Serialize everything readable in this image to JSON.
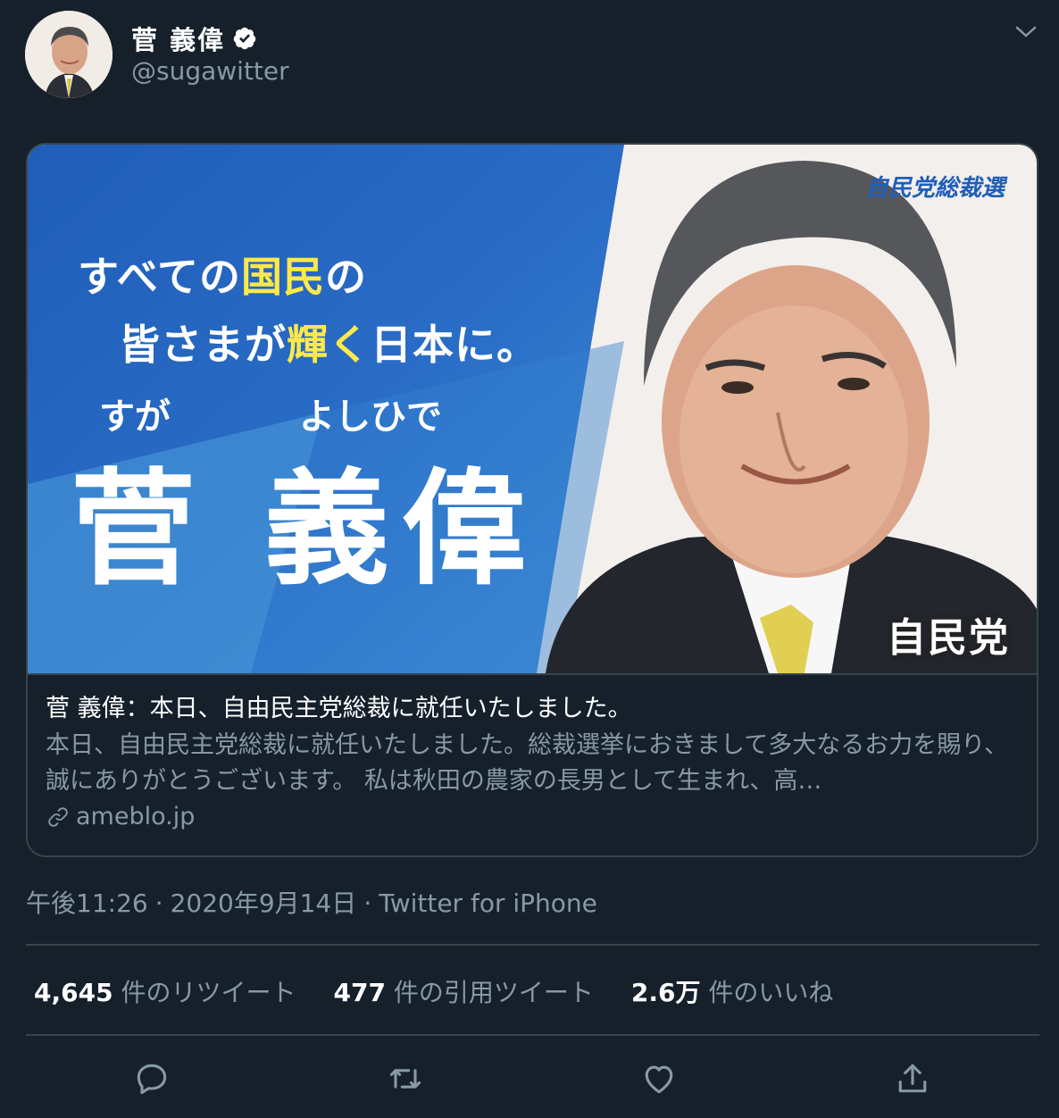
{
  "author": {
    "display_name": "菅 義偉",
    "handle": "@sugawitter",
    "verified": true
  },
  "card": {
    "image": {
      "catch_line1_a": "すべての",
      "catch_line1_b": "国民",
      "catch_line1_c": "の",
      "catch_line2_a": "皆さまが",
      "catch_line2_b": "輝く",
      "catch_line2_c": "日本に。",
      "ruby_family": "すが",
      "ruby_given": "よしひで",
      "big_name": "菅 義偉",
      "party_election": "自民党総裁選",
      "party_logo": "自民党"
    },
    "title": "菅 義偉：本日、自由民主党総裁に就任いたしました。",
    "description": "本日、自由民主党総裁に就任いたしました。総裁選挙におきまして多大なるお力を賜り、誠にありがとうございます。 私は秋田の農家の長男として生まれ、高…",
    "domain": "ameblo.jp"
  },
  "meta": {
    "time": "午後11:26",
    "date": "2020年9月14日",
    "source": "Twitter for iPhone"
  },
  "stats": {
    "retweets_count": "4,645",
    "retweets_label": "件のリツイート",
    "quotes_count": "477",
    "quotes_label": "件の引用ツイート",
    "likes_count": "2.6万",
    "likes_label": "件のいいね"
  },
  "colors": {
    "background": "#15202b",
    "border": "#38444d",
    "secondary_text": "#8899a6",
    "banner_blue": "#2a6bc4",
    "highlight_yellow": "#ffe94a"
  },
  "icons": {
    "verified": "verified-badge-icon",
    "more": "chevron-down-icon",
    "link": "link-icon",
    "reply": "reply-icon",
    "retweet": "retweet-icon",
    "like": "heart-icon",
    "share": "share-icon"
  }
}
